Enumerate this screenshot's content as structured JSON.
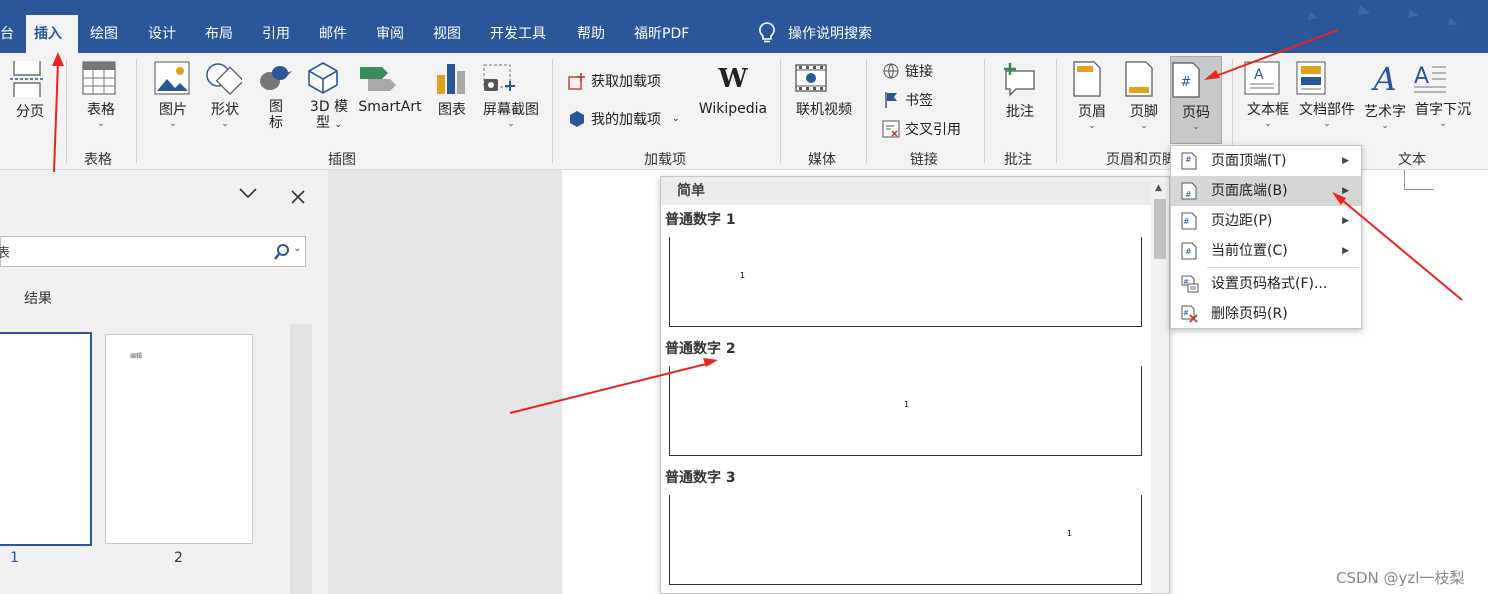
{
  "tabs": {
    "left_cut": "台",
    "items": [
      "插入",
      "绘图",
      "设计",
      "布局",
      "引用",
      "邮件",
      "审阅",
      "视图",
      "开发工具",
      "帮助",
      "福昕PDF"
    ],
    "tell_me": "操作说明搜索"
  },
  "ribbon": {
    "page_break": "分页",
    "table": "表格",
    "picture": "图片",
    "shapes": "形状",
    "icons_line1": "图",
    "icons_line2": "标",
    "model_line1": "3D 模",
    "model_line2": "型",
    "smartart": "SmartArt",
    "chart": "图表",
    "screenshot": "屏幕截图",
    "get_addins": "获取加载项",
    "my_addins": "我的加载项",
    "wikipedia": "Wikipedia",
    "online_video": "联机视频",
    "link": "链接",
    "bookmark": "书签",
    "cross_ref": "交叉引用",
    "comment": "批注",
    "header": "页眉",
    "footer": "页脚",
    "page_number": "页码",
    "textbox": "文本框",
    "quick_parts": "文档部件",
    "wordart": "艺术字",
    "dropcap": "首字下沉",
    "groups": {
      "tables": "表格",
      "illustrations": "插图",
      "addins": "加载项",
      "media": "媒体",
      "links": "链接",
      "comments": "批注",
      "header_footer": "页眉和页脚",
      "text": "文本"
    }
  },
  "nav": {
    "results_tab": "结果",
    "page1": "1",
    "page2": "2",
    "thumb_text": "编辑"
  },
  "gallery": {
    "section": "简单",
    "items": [
      {
        "label": "普通数字 1",
        "num": "1"
      },
      {
        "label": "普通数字 2",
        "num": "1"
      },
      {
        "label": "普通数字 3",
        "num": "1"
      }
    ]
  },
  "menu": {
    "items": [
      {
        "label": "页面顶端(T)"
      },
      {
        "label": "页面底端(B)"
      },
      {
        "label": "页边距(P)"
      },
      {
        "label": "当前位置(C)"
      },
      {
        "label": "设置页码格式(F)..."
      },
      {
        "label": "删除页码(R)"
      }
    ]
  },
  "watermark": "CSDN @yzl一枝梨",
  "colors": {
    "accent": "#2b579a",
    "arrow": "#e8261e"
  }
}
